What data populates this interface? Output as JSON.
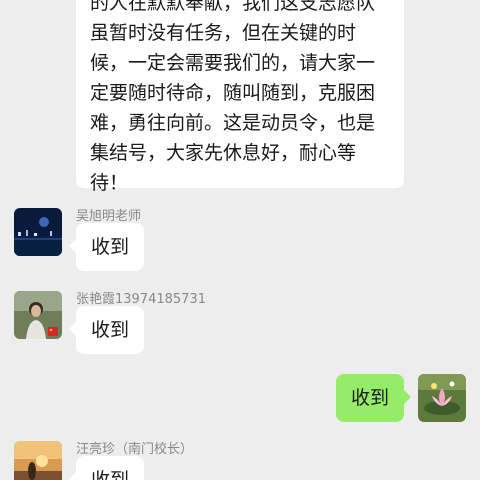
{
  "chat": {
    "long_message": {
      "lines": [
        "的人在默默奉献，我们这支志愿队",
        "虽暂时没有任务，但在关键的时",
        "候，一定会需要我们的，请大家一",
        "定要随时待命，随叫随到，克服困",
        "难，勇往向前。这是动员令，也是",
        "集结号，大家先休息好，耐心等",
        "待！"
      ]
    },
    "messages": [
      {
        "sender": "吴旭明老师",
        "text": "收到"
      },
      {
        "sender": "张艳霞13974185731",
        "text": "收到"
      },
      {
        "sender": "",
        "text": "收到"
      },
      {
        "sender": "汪亮珍（南门校长）",
        "text": "收到"
      }
    ],
    "colors": {
      "background": "#ededed",
      "incoming_bubble": "#ffffff",
      "outgoing_bubble": "#95ec69"
    }
  }
}
